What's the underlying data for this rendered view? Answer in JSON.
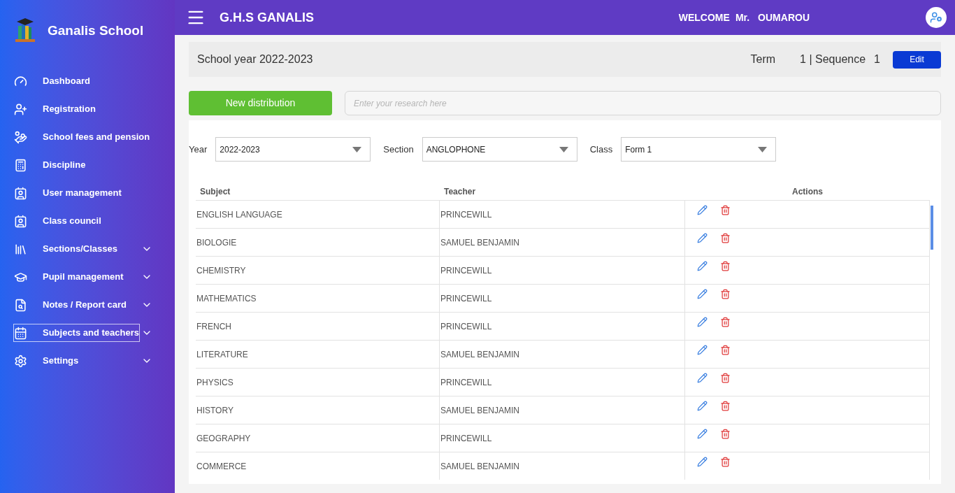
{
  "brand": {
    "name": "Ganalis School"
  },
  "sidebar": {
    "items": [
      {
        "label": "Dashboard",
        "has_submenu": false,
        "selected": false
      },
      {
        "label": "Registration",
        "has_submenu": false,
        "selected": false
      },
      {
        "label": "School fees and pension",
        "has_submenu": false,
        "selected": false
      },
      {
        "label": "Discipline",
        "has_submenu": false,
        "selected": false
      },
      {
        "label": "User management",
        "has_submenu": false,
        "selected": false
      },
      {
        "label": "Class council",
        "has_submenu": false,
        "selected": false
      },
      {
        "label": "Sections/Classes",
        "has_submenu": true,
        "selected": false
      },
      {
        "label": "Pupil management",
        "has_submenu": true,
        "selected": false
      },
      {
        "label": "Notes / Report card",
        "has_submenu": true,
        "selected": false
      },
      {
        "label": "Subjects and teachers",
        "has_submenu": true,
        "selected": true
      },
      {
        "label": "Settings",
        "has_submenu": true,
        "selected": false
      }
    ]
  },
  "header": {
    "school": "G.H.S GANALIS",
    "welcome": "WELCOME",
    "title": "Mr.",
    "user": "OUMAROU"
  },
  "period": {
    "school_year": "School year 2022-2023",
    "term_label": "Term",
    "term": "1 | Sequence",
    "sequence": "1",
    "edit": "Edit"
  },
  "toolbar": {
    "new_button": "New distribution",
    "search": {
      "placeholder": "Enter your research here"
    }
  },
  "filters": [
    {
      "label": "Year",
      "value": "2022-2023"
    },
    {
      "label": "Section",
      "value": "ANGLOPHONE"
    },
    {
      "label": "Class",
      "value": "Form 1"
    }
  ],
  "table": {
    "columns": [
      "Subject",
      "Teacher",
      "Actions"
    ],
    "rows": [
      {
        "subject": "ENGLISH LANGUAGE",
        "teacher": "PRINCEWILL"
      },
      {
        "subject": "BIOLOGIE",
        "teacher": "SAMUEL BENJAMIN"
      },
      {
        "subject": "CHEMISTRY",
        "teacher": "PRINCEWILL"
      },
      {
        "subject": "MATHEMATICS",
        "teacher": "PRINCEWILL"
      },
      {
        "subject": "FRENCH",
        "teacher": "PRINCEWILL"
      },
      {
        "subject": "LITERATURE",
        "teacher": "SAMUEL BENJAMIN"
      },
      {
        "subject": "PHYSICS",
        "teacher": "PRINCEWILL"
      },
      {
        "subject": "HISTORY",
        "teacher": "SAMUEL BENJAMIN"
      },
      {
        "subject": "GEOGRAPHY",
        "teacher": "PRINCEWILL"
      },
      {
        "subject": "COMMERCE",
        "teacher": "SAMUEL BENJAMIN"
      }
    ]
  }
}
